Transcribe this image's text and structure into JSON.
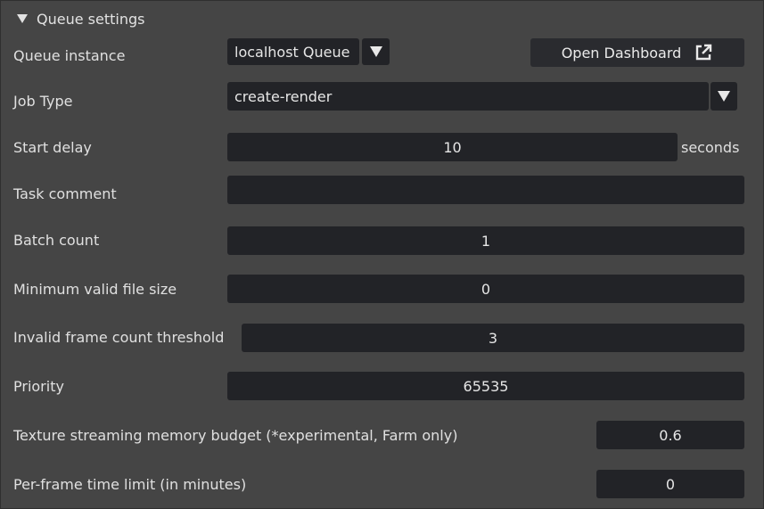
{
  "section": {
    "title": "Queue settings",
    "collapse_icon": "caret-down-icon"
  },
  "queue_instance": {
    "label": "Queue instance",
    "value": "localhost Queue",
    "open_dashboard_label": "Open Dashboard",
    "open_icon": "external-link-icon"
  },
  "job_type": {
    "label": "Job Type",
    "value": "create-render"
  },
  "start_delay": {
    "label": "Start delay",
    "value": "10",
    "unit": "seconds"
  },
  "task_comment": {
    "label": "Task comment",
    "value": ""
  },
  "batch_count": {
    "label": "Batch count",
    "value": "1"
  },
  "min_file_size": {
    "label": "Minimum valid file size",
    "value": "0"
  },
  "invalid_frame_threshold": {
    "label": "Invalid frame count threshold",
    "value": "3"
  },
  "priority": {
    "label": "Priority",
    "value": "65535"
  },
  "texture_budget": {
    "label": "Texture streaming memory budget (*experimental, Farm only)",
    "value": "0.6"
  },
  "frame_time_limit": {
    "label": "Per-frame time limit (in minutes)",
    "value": "0"
  }
}
